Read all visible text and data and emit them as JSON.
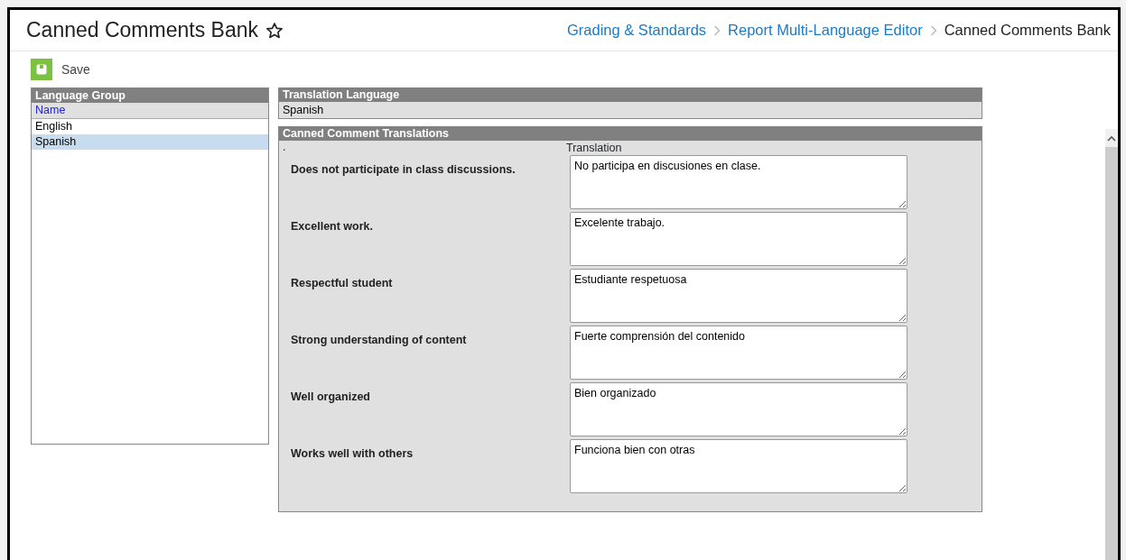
{
  "page": {
    "title": "Canned Comments Bank",
    "favorite": false
  },
  "breadcrumbs": [
    {
      "label": "Grading & Standards",
      "link": true
    },
    {
      "label": "Report Multi-Language Editor",
      "link": true
    },
    {
      "label": "Canned Comments Bank",
      "link": false
    }
  ],
  "toolbar": {
    "save_label": "Save"
  },
  "language_group": {
    "title": "Language Group",
    "column": "Name",
    "rows": [
      {
        "name": "English",
        "selected": false
      },
      {
        "name": "Spanish",
        "selected": true
      }
    ]
  },
  "translation_language": {
    "title": "Translation Language",
    "value": "Spanish"
  },
  "translations": {
    "title": "Canned Comment Translations",
    "column_1": ".",
    "column_2": "Translation",
    "rows": [
      {
        "comment": "Does not participate in class discussions.",
        "translation": "No participa en discusiones en clase."
      },
      {
        "comment": "Excellent work.",
        "translation": "Excelente trabajo."
      },
      {
        "comment": "Respectful student",
        "translation": "Estudiante respetuosa"
      },
      {
        "comment": "Strong understanding of content",
        "translation": "Fuerte comprensión del contenido"
      },
      {
        "comment": "Well organized",
        "translation": "Bien organizado"
      },
      {
        "comment": "Works well with others",
        "translation": "Funciona bien con otras"
      }
    ]
  }
}
